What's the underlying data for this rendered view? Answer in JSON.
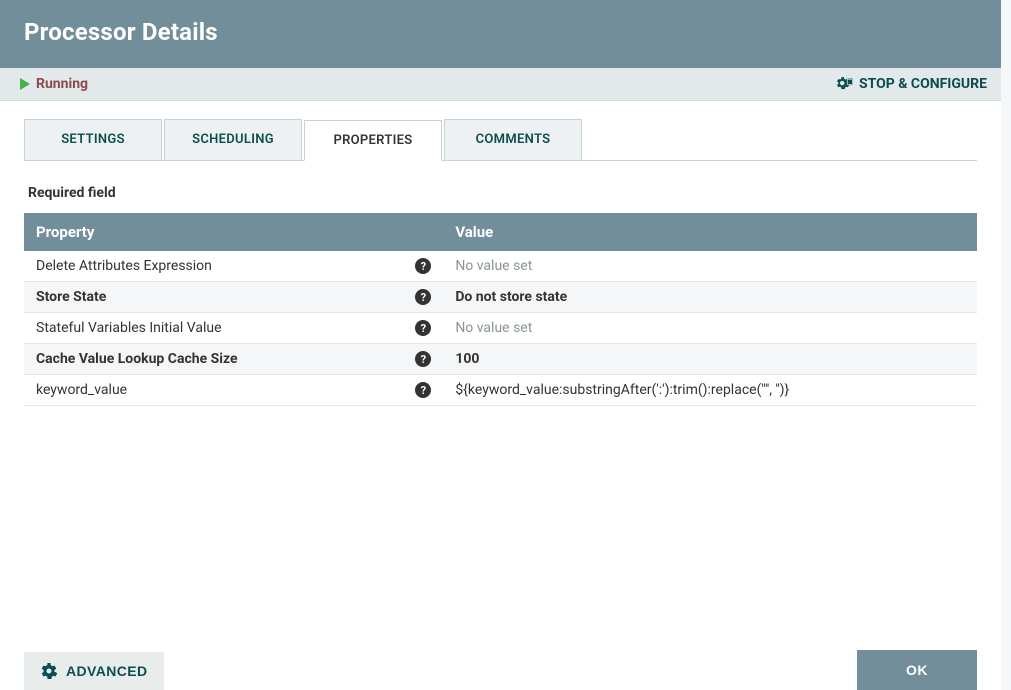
{
  "header": {
    "title": "Processor Details"
  },
  "status": {
    "state_label": "Running",
    "stop_configure_label": "STOP & CONFIGURE"
  },
  "tabs": [
    {
      "id": "settings",
      "label": "SETTINGS",
      "active": false
    },
    {
      "id": "scheduling",
      "label": "SCHEDULING",
      "active": false
    },
    {
      "id": "properties",
      "label": "PROPERTIES",
      "active": true
    },
    {
      "id": "comments",
      "label": "COMMENTS",
      "active": false
    }
  ],
  "properties": {
    "required_label": "Required field",
    "header_property": "Property",
    "header_value": "Value",
    "rows": [
      {
        "name": "Delete Attributes Expression",
        "bold": false,
        "value": "No value set",
        "value_style": "placeholder"
      },
      {
        "name": "Store State",
        "bold": true,
        "value": "Do not store state",
        "value_style": "bold"
      },
      {
        "name": "Stateful Variables Initial Value",
        "bold": false,
        "value": "No value set",
        "value_style": "placeholder"
      },
      {
        "name": "Cache Value Lookup Cache Size",
        "bold": true,
        "value": "100",
        "value_style": "bold"
      },
      {
        "name": "keyword_value",
        "bold": false,
        "value": "${keyword_value:substringAfter(':'):trim():replace('\"', '')}",
        "value_style": "normal"
      }
    ]
  },
  "footer": {
    "advanced_label": "ADVANCED",
    "ok_label": "OK"
  }
}
